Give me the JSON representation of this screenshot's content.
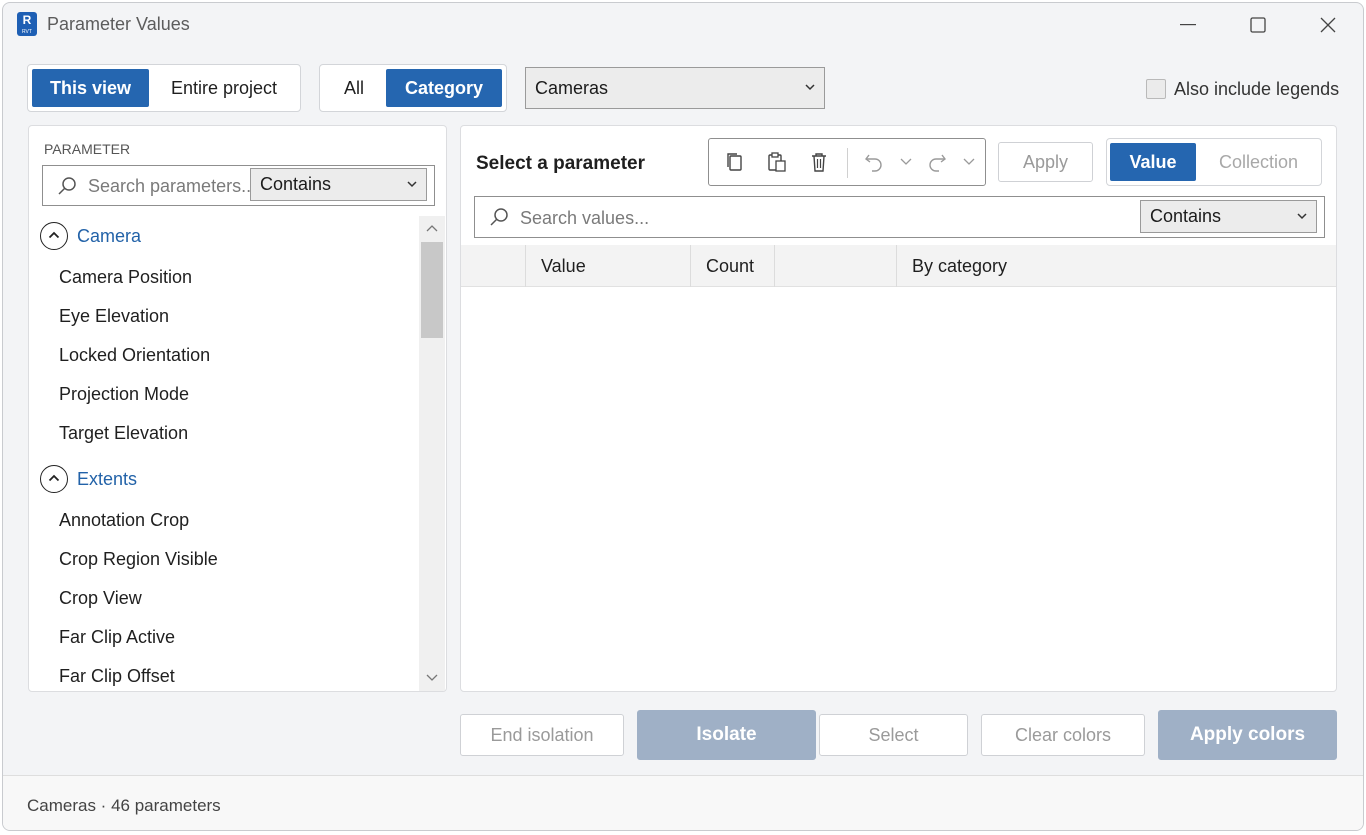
{
  "window": {
    "title": "Parameter Values",
    "app_icon_letter": "R",
    "app_icon_sub": "RVT"
  },
  "scope": {
    "options": [
      "This view",
      "Entire project"
    ],
    "selected": "This view"
  },
  "filter": {
    "options": [
      "All",
      "Category"
    ],
    "selected": "Category"
  },
  "category_select": {
    "value": "Cameras"
  },
  "legends": {
    "label": "Also include legends",
    "checked": false
  },
  "parameter_panel": {
    "header": "PARAMETER",
    "search_placeholder": "Search parameters...",
    "match_mode": "Contains",
    "groups": [
      {
        "name": "Camera",
        "expanded": true,
        "items": [
          "Camera Position",
          "Eye Elevation",
          "Locked Orientation",
          "Projection Mode",
          "Target Elevation"
        ]
      },
      {
        "name": "Extents",
        "expanded": true,
        "items": [
          "Annotation Crop",
          "Crop Region Visible",
          "Crop View",
          "Far Clip Active",
          "Far Clip Offset"
        ]
      }
    ]
  },
  "values_panel": {
    "title": "Select a parameter",
    "apply_label": "Apply",
    "mode": {
      "options": [
        "Value",
        "Collection"
      ],
      "selected": "Value"
    },
    "search_placeholder": "Search values...",
    "match_mode": "Contains",
    "columns": [
      "",
      "Value",
      "Count",
      "",
      "By category"
    ],
    "rows": []
  },
  "actions": {
    "end_isolation": "End isolation",
    "isolate": "Isolate",
    "select": "Select",
    "clear_colors": "Clear colors",
    "apply_colors": "Apply colors"
  },
  "status": {
    "text": "Cameras · 46 parameters"
  },
  "colors": {
    "accent": "#2566b0",
    "group_label": "#2262a8",
    "disabled_fill": "#9fb0c6"
  }
}
